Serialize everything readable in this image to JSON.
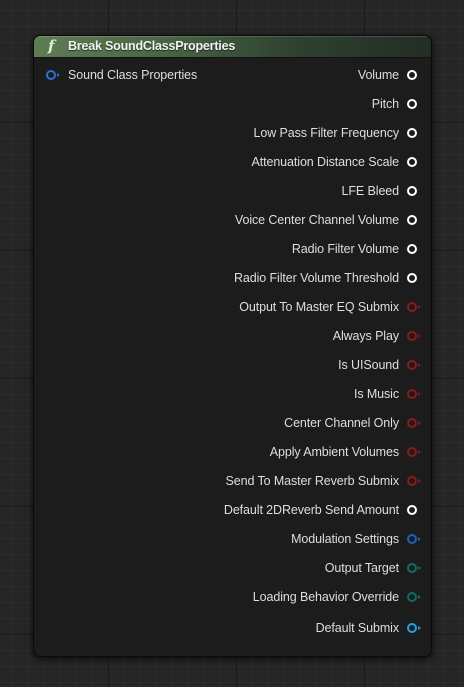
{
  "node": {
    "title": "Break SoundClassProperties",
    "icon": "function-icon",
    "icon_glyph": "f",
    "header_color": "#5e7d55"
  },
  "input_pin": {
    "label": "Sound Class Properties",
    "color": "#2f6fd8",
    "icon": "struct-pin-icon"
  },
  "output_pins": [
    {
      "label": "Volume",
      "color": "#ffffff",
      "arrow": false
    },
    {
      "label": "Pitch",
      "color": "#ffffff",
      "arrow": false
    },
    {
      "label": "Low Pass Filter Frequency",
      "color": "#ffffff",
      "arrow": false
    },
    {
      "label": "Attenuation Distance Scale",
      "color": "#ffffff",
      "arrow": false
    },
    {
      "label": "LFE Bleed",
      "color": "#ffffff",
      "arrow": false
    },
    {
      "label": "Voice Center Channel Volume",
      "color": "#ffffff",
      "arrow": false
    },
    {
      "label": "Radio Filter Volume",
      "color": "#ffffff",
      "arrow": false
    },
    {
      "label": "Radio Filter Volume Threshold",
      "color": "#ffffff",
      "arrow": false
    },
    {
      "label": "Output To Master EQ Submix",
      "color": "#8b1a1a",
      "arrow": true
    },
    {
      "label": "Always Play",
      "color": "#8b1a1a",
      "arrow": true
    },
    {
      "label": "Is UISound",
      "color": "#8b1a1a",
      "arrow": true
    },
    {
      "label": "Is Music",
      "color": "#8b1a1a",
      "arrow": true
    },
    {
      "label": "Center Channel Only",
      "color": "#8b1a1a",
      "arrow": true
    },
    {
      "label": "Apply Ambient Volumes",
      "color": "#8b1a1a",
      "arrow": true
    },
    {
      "label": "Send To Master Reverb Submix",
      "color": "#8b1a1a",
      "arrow": true
    },
    {
      "label": "Default 2DReverb Send Amount",
      "color": "#ffffff",
      "arrow": false
    },
    {
      "label": "Modulation Settings",
      "color": "#1f5fc4",
      "arrow": true
    },
    {
      "label": "Output Target",
      "color": "#0f6e60",
      "arrow": true
    },
    {
      "label": "Loading Behavior Override",
      "color": "#0f6e60",
      "arrow": true
    },
    {
      "label": "Default Submix",
      "color": "#1aa3e6",
      "arrow": true
    }
  ]
}
